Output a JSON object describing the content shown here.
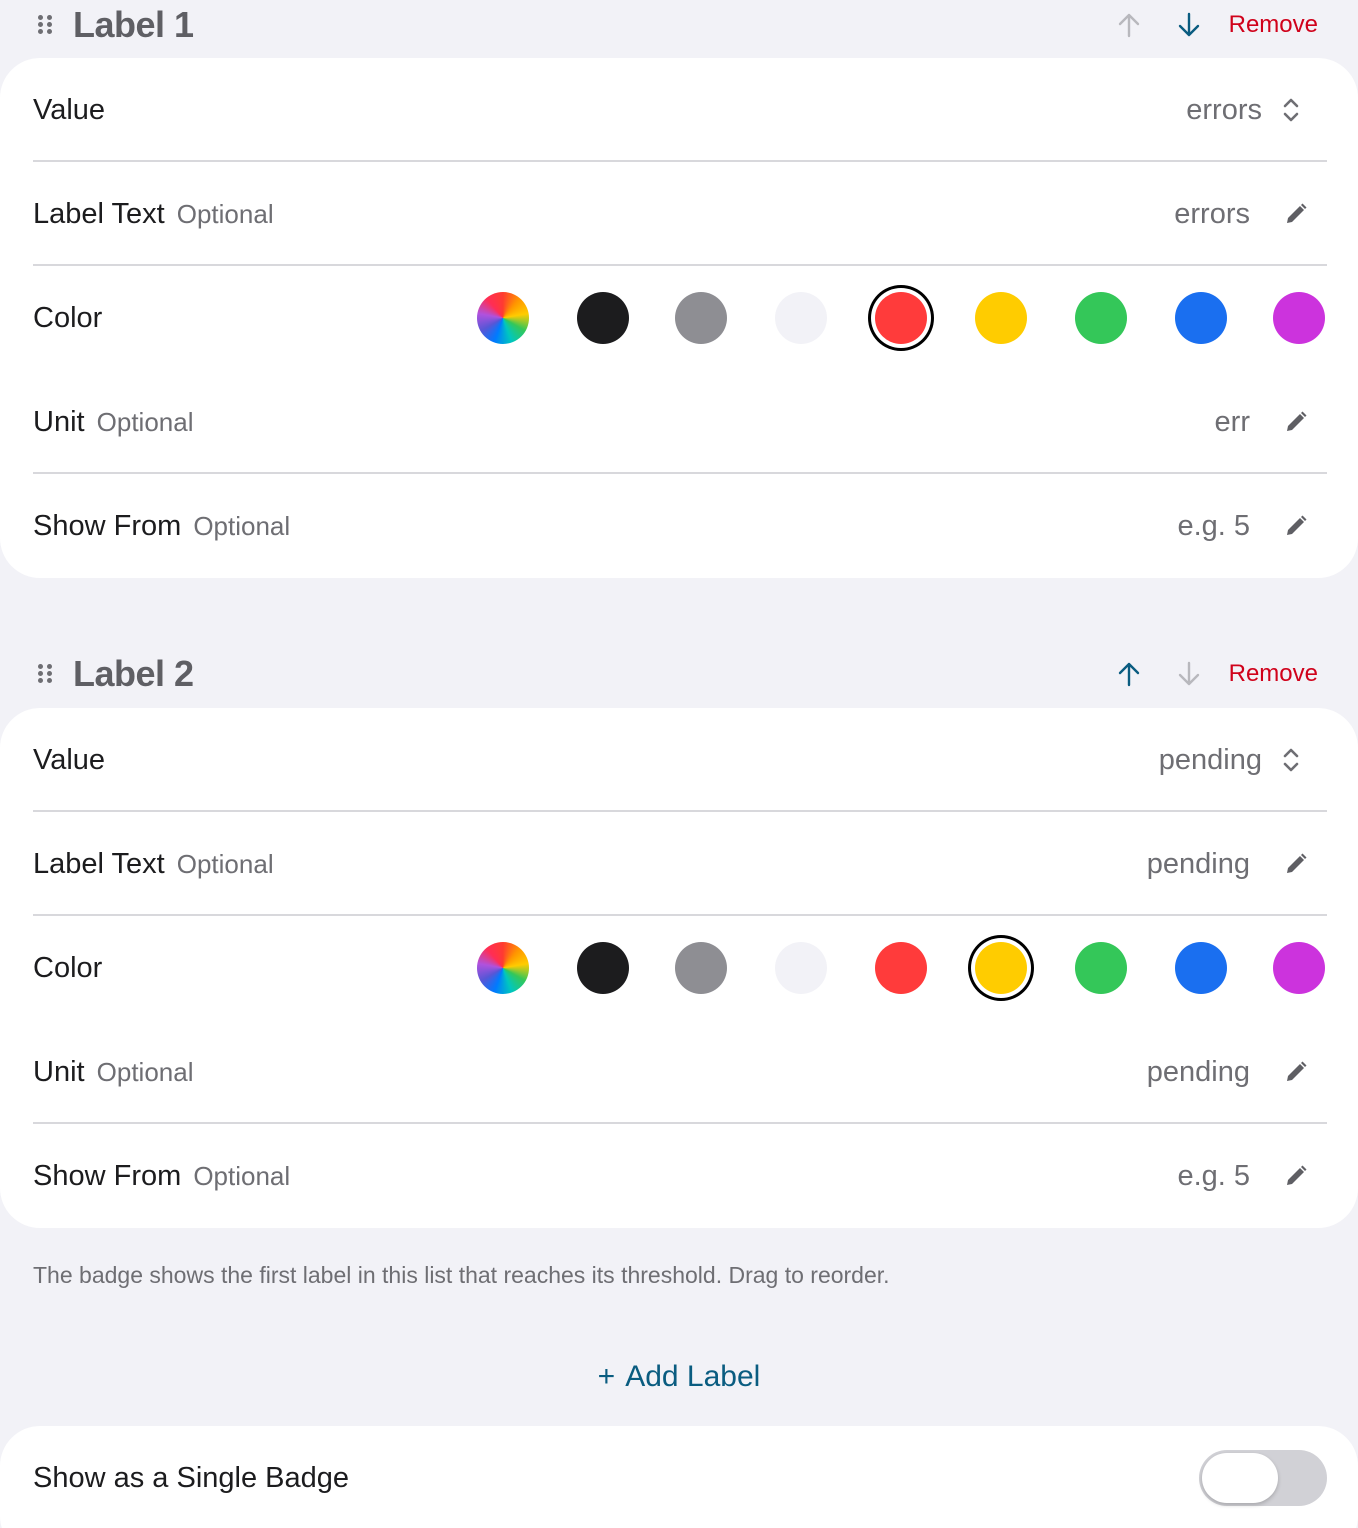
{
  "colors": {
    "accent": "#0a5c80",
    "remove": "#d0021b",
    "disabled_arrow": "#b8b8bd",
    "enabled_arrow": "#0a5c80"
  },
  "labels": [
    {
      "title": "Label 1",
      "up_enabled": false,
      "down_enabled": true,
      "remove_label": "Remove",
      "value_label": "Value",
      "value": "errors",
      "label_text_label": "Label Text",
      "label_text_optional": "Optional",
      "label_text_value": "errors",
      "color_label": "Color",
      "selected_color_index": 4,
      "unit_label": "Unit",
      "unit_optional": "Optional",
      "unit_value": "err",
      "show_from_label": "Show From",
      "show_from_optional": "Optional",
      "show_from_placeholder": "e.g. 5"
    },
    {
      "title": "Label 2",
      "up_enabled": true,
      "down_enabled": false,
      "remove_label": "Remove",
      "value_label": "Value",
      "value": "pending",
      "label_text_label": "Label Text",
      "label_text_optional": "Optional",
      "label_text_value": "pending",
      "color_label": "Color",
      "selected_color_index": 5,
      "unit_label": "Unit",
      "unit_optional": "Optional",
      "unit_value": "pending",
      "show_from_label": "Show From",
      "show_from_optional": "Optional",
      "show_from_placeholder": "e.g. 5"
    }
  ],
  "swatch_colors": [
    "rainbow",
    "#1c1c1e",
    "#8e8e93",
    "#f2f2f7",
    "#ff3b3b",
    "#ffcc00",
    "#34c759",
    "#1a6ff0",
    "#cc33dd"
  ],
  "footnote": "The badge shows the first label in this list that reaches its threshold. Drag to reorder.",
  "add_label": "Add Label",
  "add_plus": "+",
  "single_badge": {
    "label": "Show as a Single Badge",
    "on": false
  }
}
